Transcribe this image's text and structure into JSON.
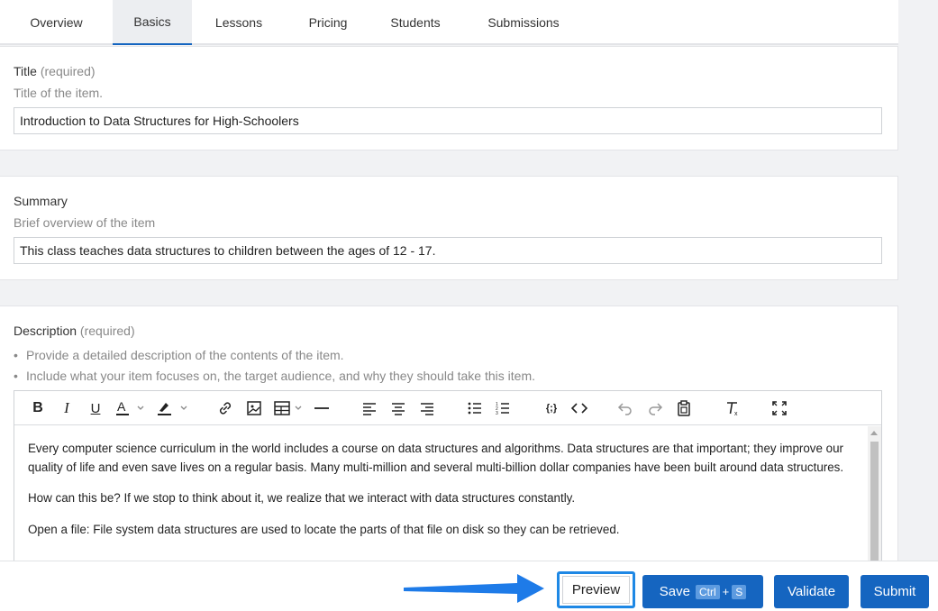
{
  "tabs": [
    "Overview",
    "Basics",
    "Lessons",
    "Pricing",
    "Students",
    "Submissions"
  ],
  "title_field": {
    "label": "Title",
    "required": "(required)",
    "help": "Title of the item.",
    "value": "Introduction to Data Structures for High-Schoolers"
  },
  "summary_field": {
    "label": "Summary",
    "help": "Brief overview of the item",
    "value": "This class teaches data structures to children between the ages of 12 - 17."
  },
  "description_field": {
    "label": "Description",
    "required": "(required)",
    "bullets": [
      "Provide a detailed description of the contents of the item.",
      "Include what your item focuses on, the target audience, and why they should take this item."
    ],
    "paragraphs": [
      "Every computer science curriculum in the world includes a course on data structures and algorithms. Data structures are that important; they improve our quality of life and even save lives on a regular basis. Many multi-million and several multi-billion dollar companies have been built around data structures.",
      "How can this be? If we stop to think about it, we realize that we interact with data structures constantly.",
      "Open a file: File system data structures are used to locate the parts of that file on disk so they can be retrieved."
    ]
  },
  "toolbar_icons": [
    "bold-icon",
    "italic-icon",
    "underline-icon",
    "text-color-icon",
    "highlight-icon",
    "link-icon",
    "image-icon",
    "table-icon",
    "horizontal-rule-icon",
    "align-left-icon",
    "align-center-icon",
    "align-right-icon",
    "bullet-list-icon",
    "numbered-list-icon",
    "code-block-icon",
    "code-icon",
    "undo-icon",
    "redo-icon",
    "paste-icon",
    "clear-format-icon",
    "fullscreen-icon"
  ],
  "footer": {
    "preview": "Preview",
    "save": "Save",
    "save_kbd_ctrl": "Ctrl",
    "save_kbd_plus": "+",
    "save_kbd_key": "S",
    "validate": "Validate",
    "submit": "Submit"
  },
  "colors": {
    "accent": "#1565c0",
    "highlight_border": "#1e88e5",
    "arrow": "#1e7be8"
  }
}
